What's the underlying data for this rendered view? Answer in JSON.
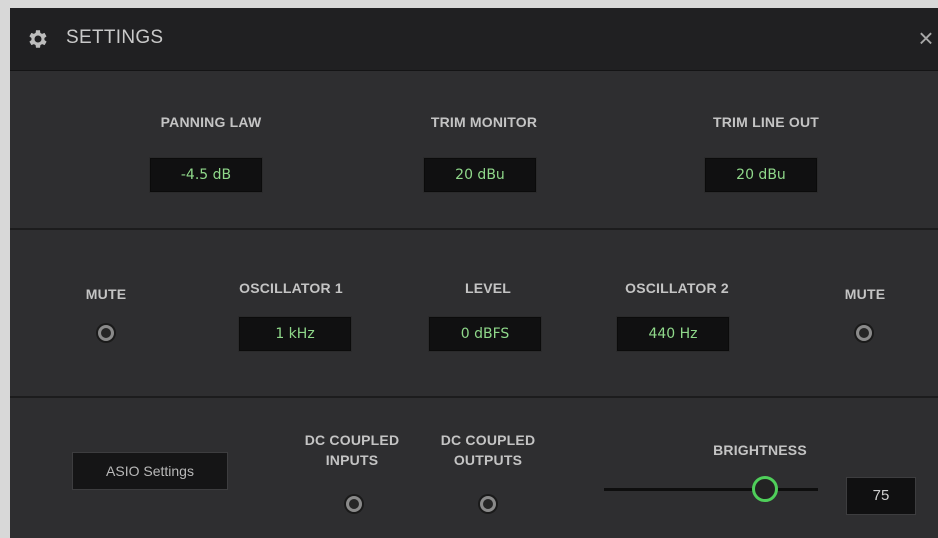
{
  "window": {
    "title": "SETTINGS",
    "icons": {
      "title": "gear-icon",
      "close": "close-icon"
    },
    "close_glyph": "×"
  },
  "monitor": {
    "panning_law": {
      "label": "PANNING LAW",
      "value": "-4.5 dB"
    },
    "trim_monitor": {
      "label": "TRIM MONITOR",
      "value": "20 dBu"
    },
    "trim_line_out": {
      "label": "TRIM LINE OUT",
      "value": "20 dBu"
    }
  },
  "oscillator": {
    "mute_left": {
      "label": "MUTE"
    },
    "osc1": {
      "label": "OSCILLATOR 1",
      "value": "1 kHz"
    },
    "level": {
      "label": "LEVEL",
      "value": "0 dBFS"
    },
    "osc2": {
      "label": "OSCILLATOR 2",
      "value": "440 Hz"
    },
    "mute_right": {
      "label": "MUTE"
    }
  },
  "device": {
    "asio_button": "ASIO Settings",
    "dc_inputs": {
      "line1": "DC COUPLED",
      "line2": "INPUTS"
    },
    "dc_outputs": {
      "line1": "DC COUPLED",
      "line2": "OUTPUTS"
    },
    "brightness": {
      "label": "BRIGHTNESS",
      "value": "75",
      "level": 0.75
    }
  },
  "colors": {
    "value_text": "#8fd88a",
    "slider_knob": "#4fcf5a",
    "background": "#2e2e30",
    "titlebar": "#202022"
  }
}
